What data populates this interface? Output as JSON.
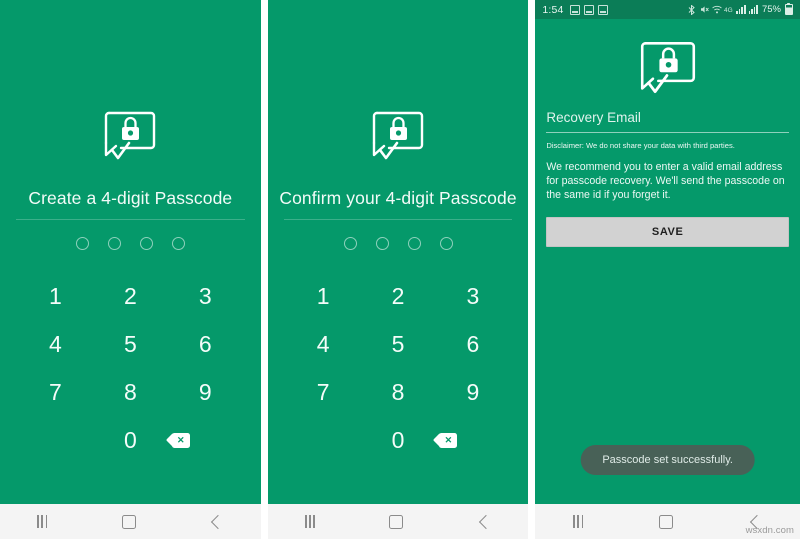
{
  "screens": [
    {
      "id": "create-passcode",
      "title": "Create a 4-digit Passcode",
      "icon": "chat-lock-icon",
      "dots": 4,
      "keys": [
        "1",
        "2",
        "3",
        "4",
        "5",
        "6",
        "7",
        "8",
        "9",
        "",
        "0",
        "backspace-icon"
      ]
    },
    {
      "id": "confirm-passcode",
      "title": "Confirm your 4-digit Passcode",
      "icon": "chat-lock-icon",
      "dots": 4,
      "keys": [
        "1",
        "2",
        "3",
        "4",
        "5",
        "6",
        "7",
        "8",
        "9",
        "",
        "0",
        "backspace-icon"
      ]
    },
    {
      "id": "recovery-email",
      "icon": "chat-lock-icon",
      "status_bar": {
        "time": "1:54",
        "battery_percent": "75%",
        "left_icons": [
          "screenshot-icon",
          "gallery-icon",
          "screen-icon"
        ],
        "right_icons": [
          "bluetooth-icon",
          "mute-icon",
          "wifi-icon",
          "data-icon",
          "signal-icon",
          "signal-two-icon",
          "battery-icon"
        ]
      },
      "email_field": {
        "placeholder": "Recovery Email",
        "value": ""
      },
      "disclaimer": "Disclaimer: We do not share your data with third parties.",
      "recommendation": "We recommend you to enter a valid email address for passcode recovery. We'll send the passcode on the same id if you forget it.",
      "save_label": "SAVE",
      "toast": "Passcode set successfully."
    }
  ],
  "navbar": {
    "recents_label": "Recents",
    "home_label": "Home",
    "back_label": "Back"
  },
  "watermark": "wsxdn.com",
  "colors": {
    "brand_green": "#05996a",
    "status_bar_green": "#0b7d57",
    "save_button": "#d2d2d2",
    "toast_background": "#4e5d56",
    "navbar_background": "#f4f4f4"
  }
}
